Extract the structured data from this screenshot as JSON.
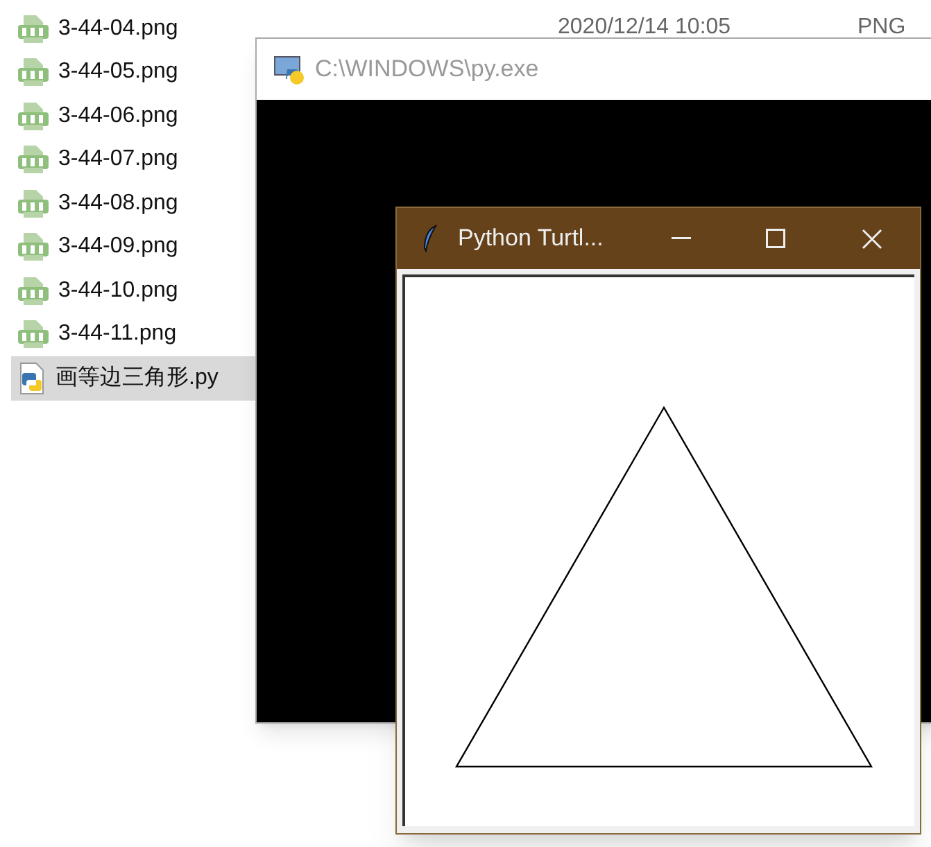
{
  "files": [
    {
      "name": "3-44-04.png",
      "kind": "png",
      "selected": false,
      "date": "2020/12/14 10:05",
      "type": "PNG"
    },
    {
      "name": "3-44-05.png",
      "kind": "png",
      "selected": false
    },
    {
      "name": "3-44-06.png",
      "kind": "png",
      "selected": false
    },
    {
      "name": "3-44-07.png",
      "kind": "png",
      "selected": false
    },
    {
      "name": "3-44-08.png",
      "kind": "png",
      "selected": false
    },
    {
      "name": "3-44-09.png",
      "kind": "png",
      "selected": false
    },
    {
      "name": "3-44-10.png",
      "kind": "png",
      "selected": false
    },
    {
      "name": "3-44-11.png",
      "kind": "png",
      "selected": false
    },
    {
      "name": "画等边三角形.py",
      "kind": "py",
      "selected": true
    }
  ],
  "console_window": {
    "title": "C:\\WINDOWS\\py.exe"
  },
  "turtle_window": {
    "title": "Python Turtl..."
  }
}
